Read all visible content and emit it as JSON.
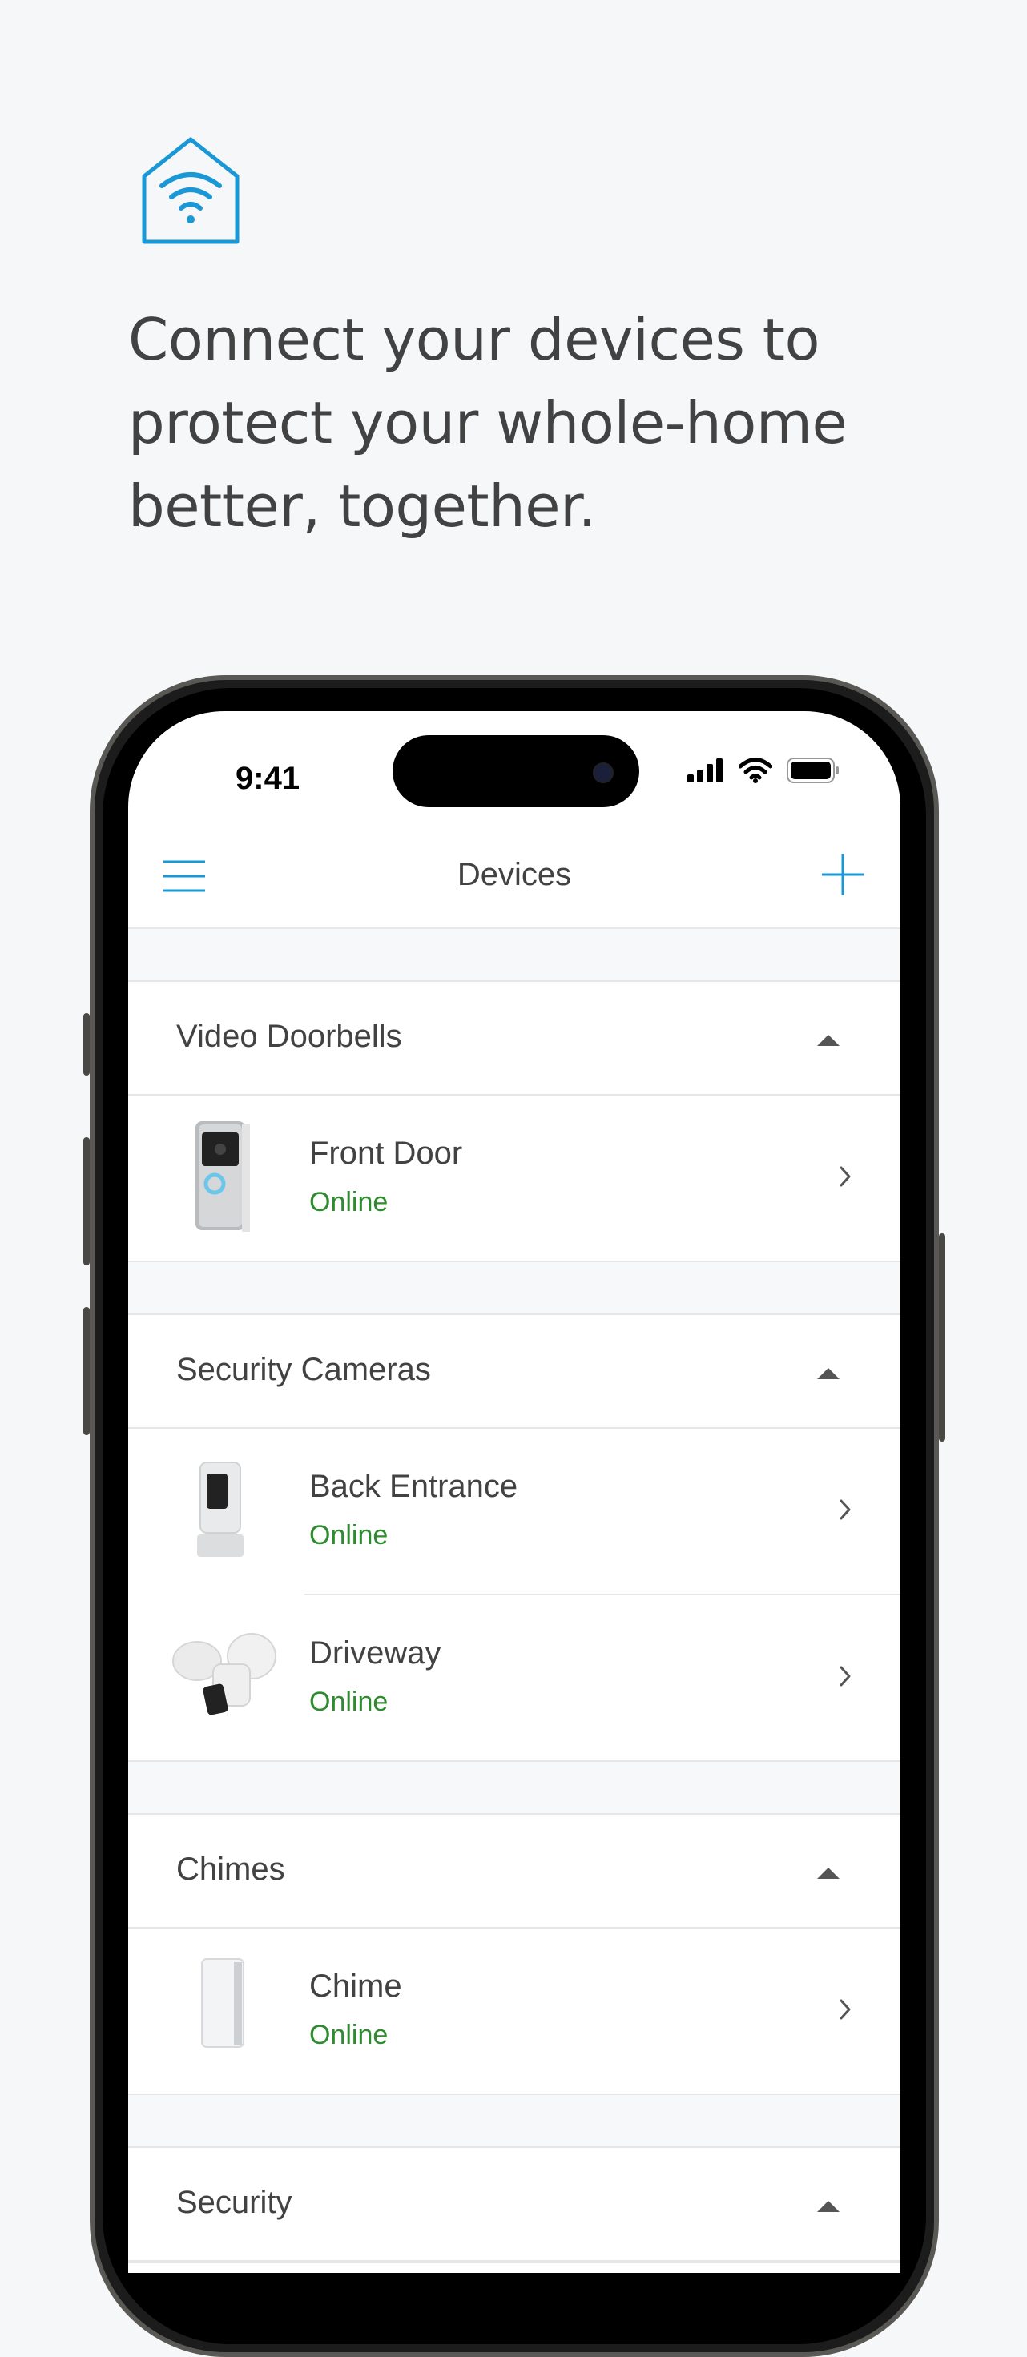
{
  "colors": {
    "accent": "#1a98d5",
    "online": "#2e8b2e",
    "text": "#424242",
    "background": "#f6f7f9"
  },
  "hero": {
    "icon": "smart-home-wifi-icon",
    "headline_lines": [
      "Connect your devices to",
      "protect your whole-home",
      "better, together."
    ]
  },
  "status_bar": {
    "time": "9:41"
  },
  "navbar": {
    "title": "Devices",
    "menu_icon": "hamburger-icon",
    "add_icon": "plus-icon"
  },
  "sections": [
    {
      "title": "Video Doorbells",
      "devices": [
        {
          "name": "Front Door",
          "status": "Online",
          "thumb": "doorbell-icon"
        }
      ]
    },
    {
      "title": "Security Cameras",
      "devices": [
        {
          "name": "Back Entrance",
          "status": "Online",
          "thumb": "stick-up-cam-icon"
        },
        {
          "name": "Driveway",
          "status": "Online",
          "thumb": "floodlight-cam-icon"
        }
      ]
    },
    {
      "title": "Chimes",
      "devices": [
        {
          "name": "Chime",
          "status": "Online",
          "thumb": "chime-icon"
        }
      ]
    },
    {
      "title": "Security",
      "devices": []
    }
  ]
}
